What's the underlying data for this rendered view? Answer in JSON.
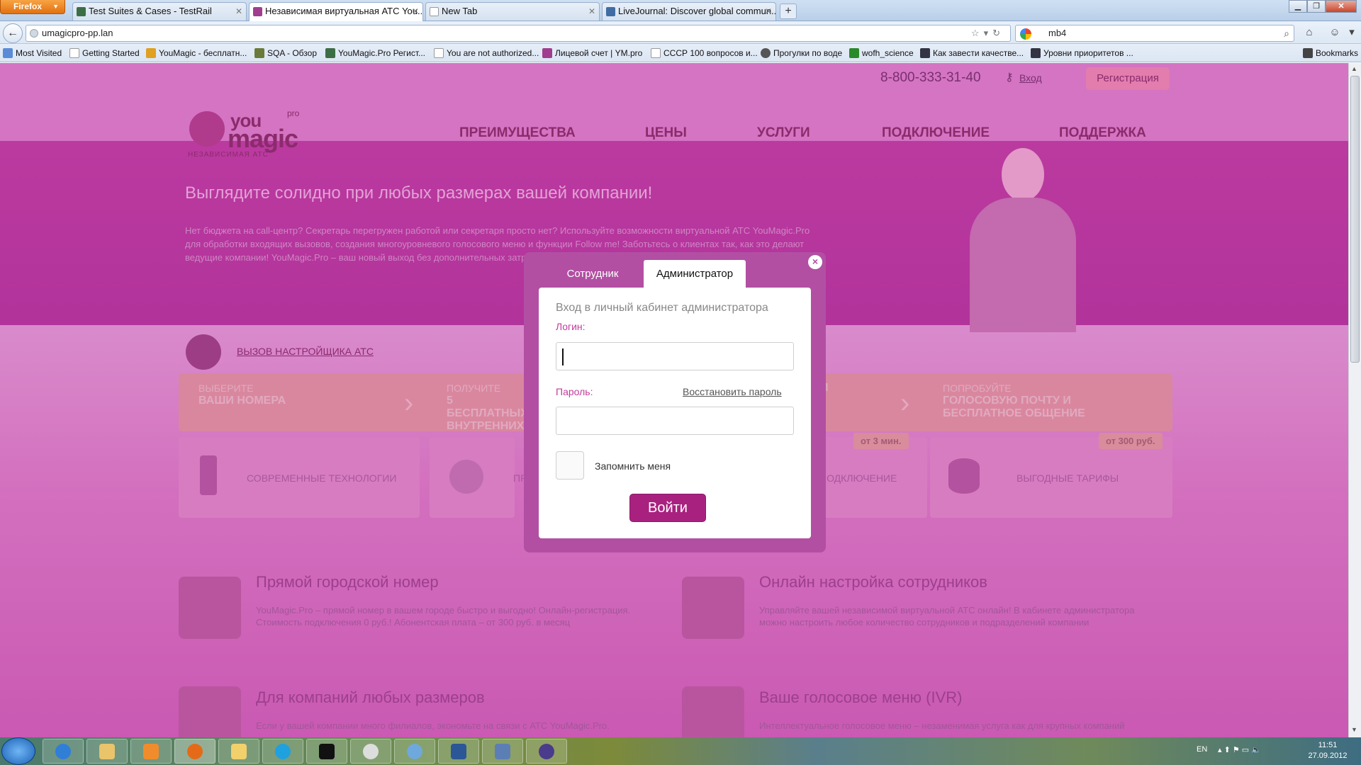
{
  "browser": {
    "firefox_label": "Firefox",
    "tabs": [
      {
        "label": "Test Suites & Cases - TestRail",
        "active": false
      },
      {
        "label": "Независимая виртуальная АТС You...",
        "active": true
      },
      {
        "label": "New Tab",
        "active": false
      },
      {
        "label": "LiveJournal: Discover global commun...",
        "active": false
      }
    ],
    "new_tab": "+",
    "url": "umagicpro-pp.lan",
    "search_value": "mb4",
    "bookmarks": [
      "Most Visited",
      "Getting Started",
      "YouMagic - бесплатн...",
      "SQA - Обзор",
      "YouMagic.Pro Регист...",
      "You are not authorized...",
      "Лицевой счет | YM.pro",
      "СССР 100 вопросов и...",
      "Прогулки по воде",
      "wofh_science",
      "Как завести качестве...",
      "Уровни приоритетов ..."
    ],
    "bookmarks_menu": "Bookmarks"
  },
  "site": {
    "phone": "8-800-333-31-40",
    "login_link": "Вход",
    "register_button": "Регистрация",
    "logo": {
      "you": "you",
      "magic": "magic",
      "pro": "pro",
      "tagline": "НЕЗАВИСИМАЯ АТС"
    },
    "nav": [
      "ПРЕИМУЩЕСТВА",
      "ЦЕНЫ",
      "УСЛУГИ",
      "ПОДКЛЮЧЕНИЕ",
      "ПОДДЕРЖКА"
    ],
    "hero_title": "Выглядите солидно при любых размерах вашей компании!",
    "hero_text": "Нет бюджета на call-центр? Секретарь перегружен работой или секретаря просто нет? Используйте возможности виртуальной АТС YouMagic.Pro для обработки входящих вызовов, создания многоуровневого голосового меню и функции Follow me! Заботьтесь о клиентах так, как это делают ведущие компании! YouMagic.Pro – ваш новый выход без дополнительных затрат всего от 300 руб. в месяц. Без платы за подключения!",
    "setup_link": "ВЫЗОВ НАСТРОЙЩИКА АТС",
    "steps": [
      {
        "small": "ВЫБЕРИТЕ",
        "big": "ВАШИ НОМЕРА"
      },
      {
        "small": "ПОЛУЧИТЕ",
        "big": "5 БЕСПЛАТНЫХ ВНУТРЕННИХ"
      },
      {
        "small": "",
        "big": "И"
      },
      {
        "small": "ПОПРОБУЙТЕ",
        "big": "ГОЛОСОВУЮ ПОЧТУ И БЕСПЛАТНОЕ ОБЩЕНИЕ"
      }
    ],
    "features": [
      {
        "label": "СОВРЕМЕННЫЕ ТЕХНОЛОГИИ",
        "badge": ""
      },
      {
        "label": "ПРО",
        "badge": ""
      },
      {
        "label": "ПОДКЛЮЧЕНИЕ",
        "badge": "от 3 мин."
      },
      {
        "label": "ВЫГОДНЫЕ ТАРИФЫ",
        "badge": "от 300 руб."
      }
    ],
    "services": [
      {
        "title": "Прямой городской номер",
        "text": "YouMagic.Pro – прямой номер в вашем городе быстро и выгодно! Онлайн-регистрация. Стоимость подключения 0 руб.! Абонентская плата – от 300 руб. в месяц"
      },
      {
        "title": "Онлайн настройка сотрудников",
        "text": "Управляйте вашей независимой виртуальной АТС онлайн! В кабинете администратора можно настроить любое количество сотрудников и подразделений компании"
      },
      {
        "title": "Для компаний любых размеров",
        "text": "Если у вашей компании много филиалов, экономьте на связи с АТС YouMagic.Pro."
      },
      {
        "title": "Ваше голосовое меню (IVR)",
        "text": "Интеллектуальное голосовое меню – незаменимая услуга как для крупных компаний"
      }
    ]
  },
  "modal": {
    "tab_employee": "Сотрудник",
    "tab_admin": "Администратор",
    "close": "×",
    "title": "Вход в личный кабинет администратора",
    "login_label": "Логин:",
    "login_value": "",
    "password_label": "Пароль:",
    "restore_link": "Восстановить пароль",
    "remember_label": "Запомнить меня",
    "submit": "Войти"
  },
  "taskbar": {
    "lang": "EN",
    "time": "11:51",
    "date": "27.09.2012"
  },
  "colors": {
    "page_magenta": "#b8329b",
    "modal_border": "#b24fa3",
    "submit": "#a9217f"
  }
}
